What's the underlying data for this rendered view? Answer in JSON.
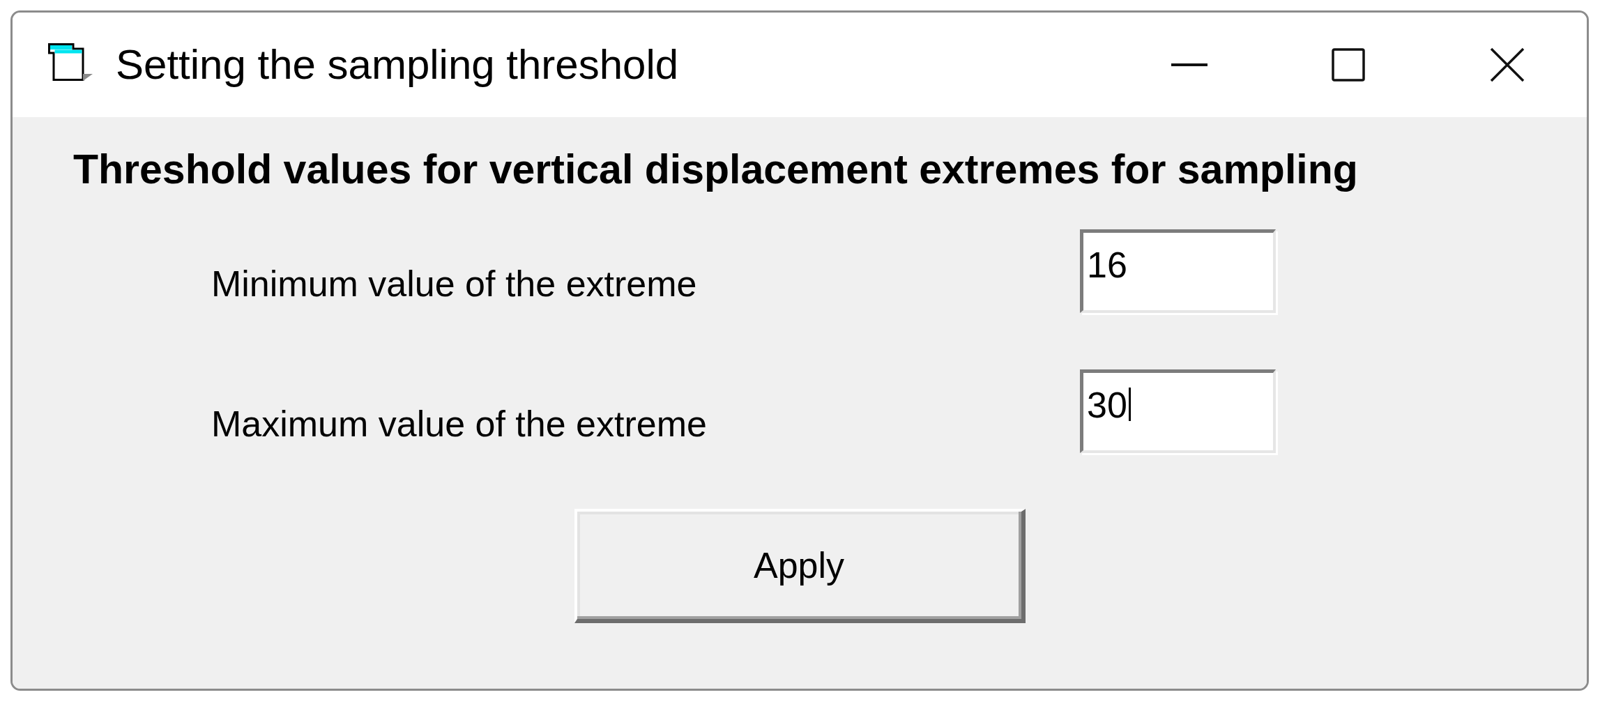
{
  "window": {
    "title": "Setting the sampling threshold",
    "controls": [
      {
        "kind": "minimize"
      },
      {
        "kind": "maximize"
      },
      {
        "kind": "close"
      }
    ]
  },
  "heading": "Threshold values for vertical displacement extremes for sampling",
  "fields": [
    {
      "label": "Minimum value of the extreme",
      "value": "16",
      "focused": false
    },
    {
      "label": "Maximum value of the extreme",
      "value": "30",
      "focused": true
    }
  ],
  "buttons": [
    {
      "label": "Apply"
    }
  ]
}
